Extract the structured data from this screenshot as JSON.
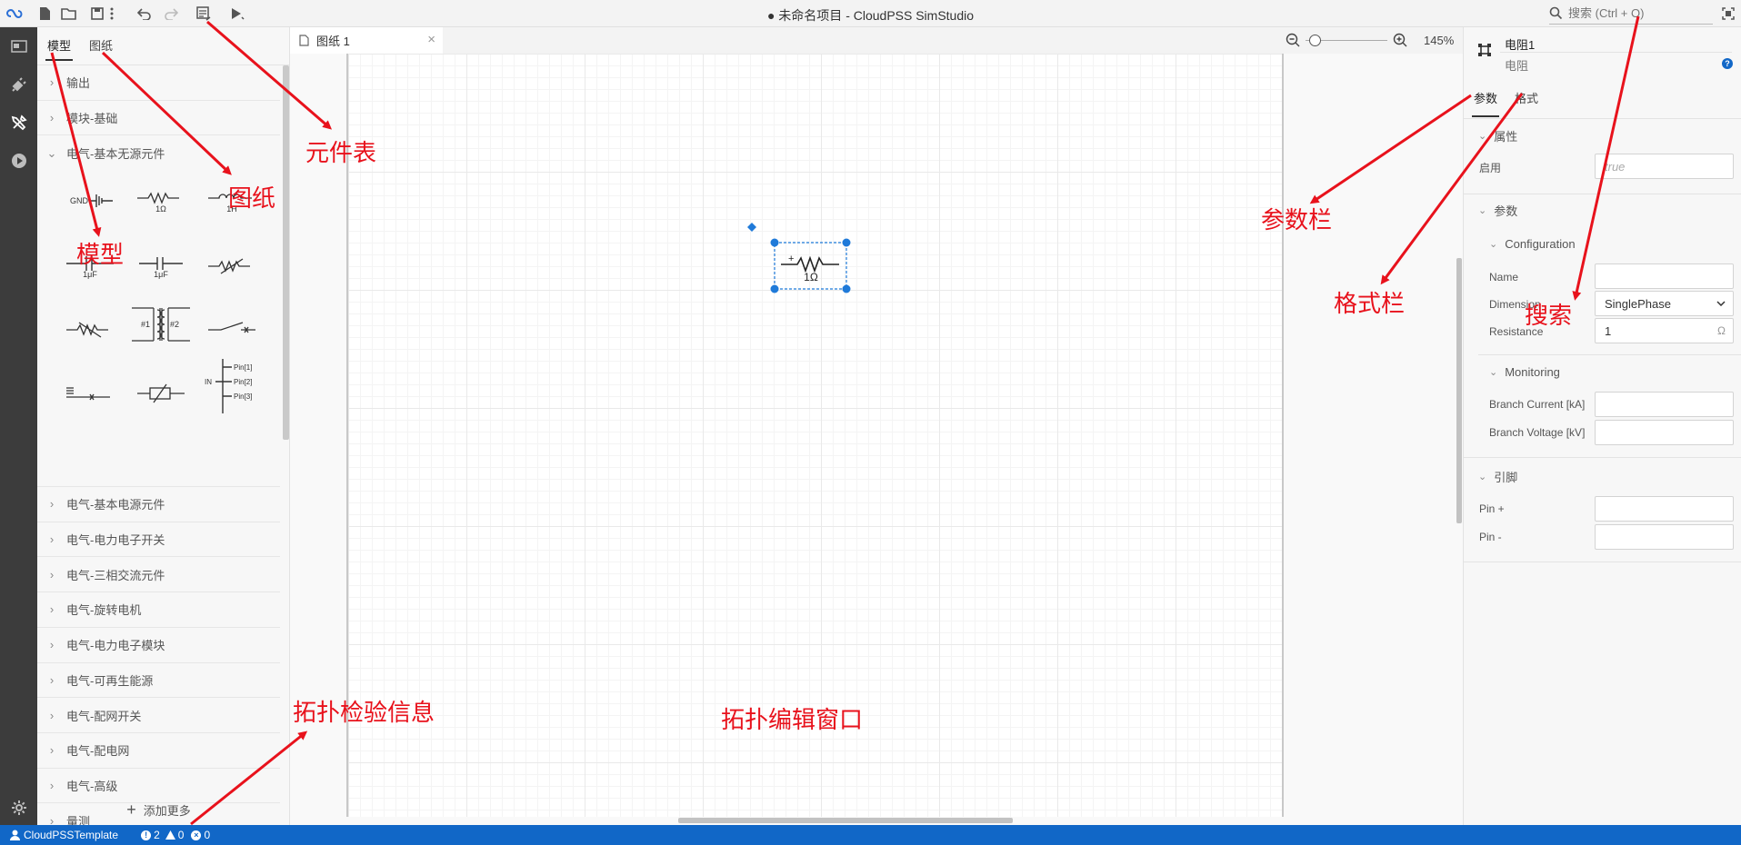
{
  "window": {
    "title": "● 未命名项目 - CloudPSS SimStudio"
  },
  "search": {
    "placeholder": "搜索 (Ctrl + O)"
  },
  "left_panel": {
    "tabs": [
      {
        "label": "模型"
      },
      {
        "label": "图纸"
      }
    ],
    "categories_top": [
      {
        "label": "输出"
      },
      {
        "label": "模块-基础"
      }
    ],
    "expanded_category": {
      "label": "电气-基本无源元件"
    },
    "palette": {
      "gnd": "GND",
      "r_value": "1Ω",
      "l_value": "1H",
      "c1_value": "1μF",
      "c2_value": "1μF",
      "t1": "#1",
      "t2": "#2",
      "bus_in": "IN",
      "pin1": "Pin[1]",
      "pin2": "Pin[2]",
      "pin3": "Pin[3]"
    },
    "categories_bottom": [
      {
        "label": "电气-基本电源元件"
      },
      {
        "label": "电气-电力电子开关"
      },
      {
        "label": "电气-三相交流元件"
      },
      {
        "label": "电气-旋转电机"
      },
      {
        "label": "电气-电力电子模块"
      },
      {
        "label": "电气-可再生能源"
      },
      {
        "label": "电气-配网开关"
      },
      {
        "label": "电气-配电网"
      },
      {
        "label": "电气-高级"
      },
      {
        "label": "量测"
      }
    ],
    "add_more": "添加更多"
  },
  "editor": {
    "tab_label": "图纸 1",
    "zoom": "145%",
    "component": {
      "value_label": "1Ω",
      "plus": "+"
    }
  },
  "right_panel": {
    "component_name": "电阻1",
    "component_type": "电阻",
    "tabs": [
      {
        "label": "参数"
      },
      {
        "label": "格式"
      }
    ],
    "section_attr": "属性",
    "enable_label": "启用",
    "enable_placeholder": "true",
    "section_params": "参数",
    "group_config": "Configuration",
    "name_label": "Name",
    "name_value": "",
    "dimension_label": "Dimension",
    "dimension_value": "SinglePhase",
    "resistance_label": "Resistance",
    "resistance_value": "1",
    "resistance_unit": "Ω",
    "group_monitoring": "Monitoring",
    "branch_current_label": "Branch Current [kA]",
    "branch_voltage_label": "Branch Voltage [kV]",
    "section_pins": "引脚",
    "pin_plus_label": "Pin +",
    "pin_minus_label": "Pin -"
  },
  "status_bar": {
    "user": "CloudPSSTemplate",
    "info_count": "2",
    "warning_count": "0",
    "error_count": "0"
  },
  "annotations": {
    "palette_table": "元件表",
    "sheet": "图纸",
    "model": "模型",
    "topology_info": "拓扑检验信息",
    "topology_editor": "拓扑编辑窗口",
    "params_bar": "参数栏",
    "format_bar": "格式栏",
    "search": "搜索"
  },
  "colors": {
    "accent": "#1167c7",
    "annotation": "#e8121c",
    "activity_bar": "#3c3c3c",
    "selection": "#1f7ad9"
  }
}
